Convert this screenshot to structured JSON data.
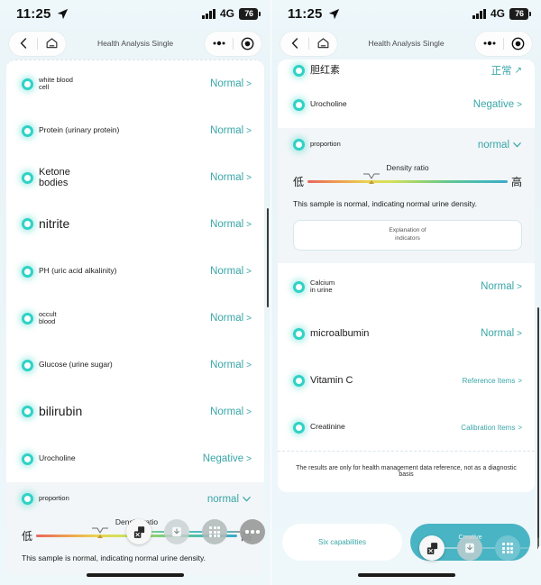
{
  "status_bar": {
    "time": "11:25",
    "network": "4G",
    "battery": "76",
    "location_icon": "location-arrow-icon"
  },
  "nav": {
    "title": "Health Analysis Single",
    "back_icon": "back-chevron-icon",
    "home_icon": "home-icon",
    "more_icon": "more-dots-icon",
    "target_icon": "target-record-icon"
  },
  "left_screen": {
    "rows": [
      {
        "label": "white blood\ncell",
        "value": "Normal",
        "chev": ">",
        "size": "xs",
        "val_size": "md"
      },
      {
        "label": "Protein (urinary protein)",
        "value": "Normal",
        "chev": ">",
        "size": "sm",
        "val_size": "md"
      },
      {
        "label": "Ketone\nbodies",
        "value": "Normal",
        "chev": ">",
        "size": "md",
        "val_size": "md"
      },
      {
        "label": "nitrite",
        "value": "Normal",
        "chev": ">",
        "size": "lg",
        "val_size": "md"
      },
      {
        "label": "PH (uric acid alkalinity)",
        "value": "Normal",
        "chev": ">",
        "size": "sm",
        "val_size": "md"
      },
      {
        "label": "occult\nblood",
        "value": "Normal",
        "chev": ">",
        "size": "xs",
        "val_size": "md"
      },
      {
        "label": "Glucose (urine sugar)",
        "value": "Normal",
        "chev": ">",
        "size": "sm",
        "val_size": "md"
      },
      {
        "label": "bilirubin",
        "value": "Normal",
        "chev": ">",
        "size": "lg",
        "val_size": "md"
      },
      {
        "label": "Urocholine",
        "value": "Negative",
        "chev": ">",
        "size": "sm",
        "val_size": "md"
      }
    ],
    "density": {
      "label": "proportion",
      "value": "normal",
      "ratio_title": "Density ratio",
      "low": "低",
      "high": "高",
      "note": "This sample is normal, indicating normal urine density.",
      "marker_percent": 32
    }
  },
  "right_screen": {
    "top_row": {
      "label": "胆红素",
      "value": "正常",
      "chev": "↗"
    },
    "rows_top": [
      {
        "label": "Urocholine",
        "value": "Negative",
        "chev": ">",
        "size": "sm",
        "val_size": "md"
      }
    ],
    "density": {
      "label": "proportion",
      "value": "normal",
      "ratio_title": "Density ratio",
      "low": "低",
      "high": "高",
      "note": "This sample is normal, indicating normal urine density.",
      "marker_percent": 32,
      "explain_button": "Explanation of\nindicators"
    },
    "rows_bottom": [
      {
        "label": "Calcium\nin urine",
        "value": "Normal",
        "chev": ">",
        "size": "xs",
        "val_size": "md"
      },
      {
        "label": "microalbumin",
        "value": "Normal",
        "chev": ">",
        "size": "md",
        "val_size": "md"
      },
      {
        "label": "Vitamin C",
        "value": "Reference Items",
        "chev": ">",
        "size": "md",
        "val_size": "sm"
      },
      {
        "label": "Creatinine",
        "value": "Calibration Items",
        "chev": ">",
        "size": "sm",
        "val_size": "sm"
      }
    ],
    "disclaimer": "The results are only for health management data reference, not as a diagnostic basis",
    "footer": {
      "six_capabilities": "Six capabilities",
      "teal_button_line1": "Creative",
      "teal_button_line2": "2"
    }
  },
  "dock": {
    "screenshot_icon": "screenshot-icon",
    "download_icon": "download-icon",
    "grid_icon": "grid-apps-icon",
    "more_icon": "more-dots-icon"
  },
  "colors": {
    "accent": "#3aa6a8",
    "dot": "#2fd2c5",
    "teal_button": "#49b4c4"
  }
}
